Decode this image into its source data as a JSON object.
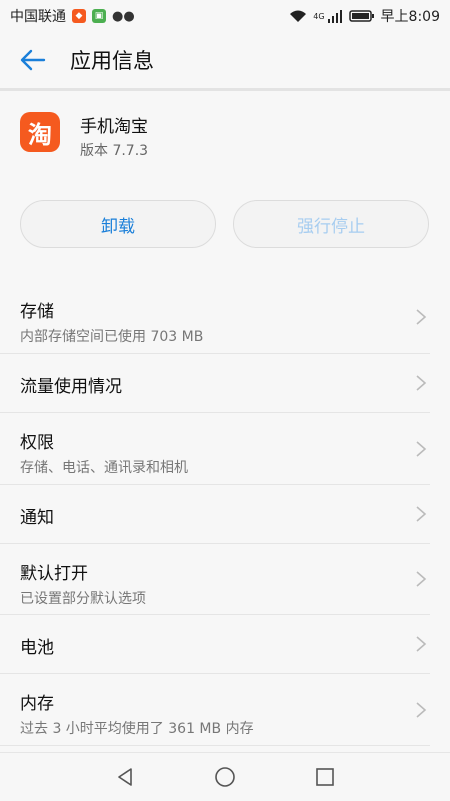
{
  "status_bar": {
    "carrier": "中国联通",
    "time": "早上8:09",
    "network_label": "4G"
  },
  "header": {
    "title": "应用信息"
  },
  "app": {
    "name": "手机淘宝",
    "version": "版本 7.7.3",
    "icon_char": "淘",
    "icon_color": "#f55a1f"
  },
  "buttons": {
    "uninstall": "卸载",
    "force_stop": "强行停止"
  },
  "list": [
    {
      "title": "存储",
      "sub": "内部存储空间已使用 703 MB"
    },
    {
      "title": "流量使用情况",
      "sub": ""
    },
    {
      "title": "权限",
      "sub": "存储、电话、通讯录和相机"
    },
    {
      "title": "通知",
      "sub": ""
    },
    {
      "title": "默认打开",
      "sub": "已设置部分默认选项"
    },
    {
      "title": "电池",
      "sub": ""
    },
    {
      "title": "内存",
      "sub": "过去 3 小时平均使用了 361 MB 内存"
    }
  ],
  "colors": {
    "accent": "#1a7fd9",
    "disabled_accent": "#a7cdf0"
  }
}
